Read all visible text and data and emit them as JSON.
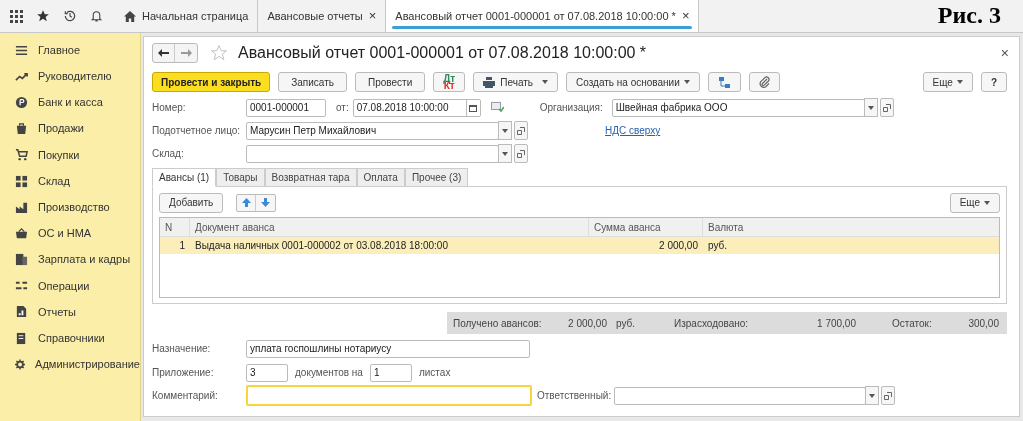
{
  "figure_label": "Рис. 3",
  "tabs": [
    {
      "label": "Начальная страница",
      "home": true,
      "selected": false
    },
    {
      "label": "Авансовые отчеты",
      "home": false,
      "close": "×",
      "selected": false
    },
    {
      "label": "Авансовый отчет 0001-000001 от 07.08.2018 10:00:00 *",
      "home": false,
      "close": "×",
      "selected": true
    }
  ],
  "sidebar": {
    "items": [
      {
        "label": "Главное"
      },
      {
        "label": "Руководителю"
      },
      {
        "label": "Банк и касса"
      },
      {
        "label": "Продажи"
      },
      {
        "label": "Покупки"
      },
      {
        "label": "Склад"
      },
      {
        "label": "Производство"
      },
      {
        "label": "ОС и НМА"
      },
      {
        "label": "Зарплата и кадры"
      },
      {
        "label": "Операции"
      },
      {
        "label": "Отчеты"
      },
      {
        "label": "Справочники"
      },
      {
        "label": "Администрирование"
      }
    ]
  },
  "document": {
    "title": "Авансовый отчет 0001-000001 от 07.08.2018 10:00:00 *",
    "favorite": false,
    "close": "×",
    "toolbar": [
      {
        "kind": "primary",
        "label": "Провести и закрыть"
      },
      {
        "kind": "button",
        "label": "Записать"
      },
      {
        "kind": "button",
        "label": "Провести"
      },
      {
        "kind": "dtkt",
        "top": "Дт",
        "bottom": "Кт"
      },
      {
        "kind": "print",
        "label": "Печать"
      },
      {
        "kind": "dropdown",
        "label": "Создать на основании"
      },
      {
        "kind": "structure"
      },
      {
        "kind": "clip"
      }
    ],
    "more": "Еще",
    "help": "?",
    "number": {
      "label": "Номер:",
      "value": "0001-000001"
    },
    "date": {
      "label": "от:",
      "value": "07.08.2018 10:00:00"
    },
    "organization": {
      "label": "Организация:",
      "value": "Швейная фабрика ООО"
    },
    "vat_link": "НДС сверху",
    "person": {
      "label": "Подотчетное лицо:",
      "value": "Марусин Петр Михайлович"
    },
    "warehouse": {
      "label": "Склад:"
    },
    "pages": [
      {
        "label": "Авансы (1)",
        "selected": true
      },
      {
        "label": "Товары",
        "selected": false
      },
      {
        "label": "Возвратная тара",
        "selected": false
      },
      {
        "label": "Оплата",
        "selected": false
      },
      {
        "label": "Прочее (3)",
        "selected": false
      }
    ],
    "add": "Добавить",
    "table_more": "Еще",
    "table": {
      "columns": [
        "N",
        "Документ аванса",
        "Сумма аванса",
        "Валюта"
      ],
      "rows": [
        {
          "cells": [
            "1",
            "Выдача наличных 0001-000002 от 03.08.2018 18:00:00",
            "2 000,00",
            "руб."
          ],
          "selected": true
        }
      ]
    },
    "totals": [
      {
        "label": "Получено авансов:",
        "value": "2 000,00",
        "unit": "руб."
      },
      {
        "label": "Израсходовано:",
        "value": "1 700,00"
      },
      {
        "label": "Остаток:",
        "value": "300,00"
      }
    ],
    "purpose": {
      "label": "Назначение:",
      "value": "уплата госпошлины нотариусу"
    },
    "attachment": {
      "label": "Приложение:",
      "docs": "3",
      "middle": "документов на",
      "sheets": "1",
      "tail": "листах"
    },
    "comment": {
      "label": "Комментарий:",
      "focused": true
    },
    "responsible": {
      "label": "Ответственный:"
    }
  }
}
